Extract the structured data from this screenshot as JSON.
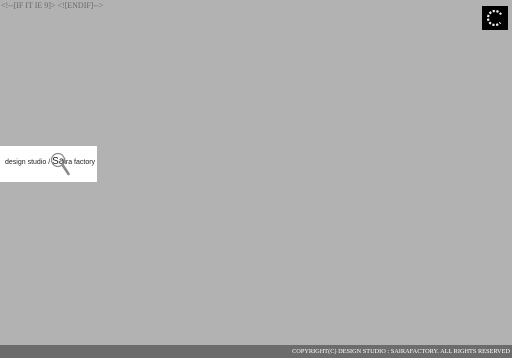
{
  "page": {
    "stray_comment": "<!--[IF IT IE 9]> <![ENDIF]-->"
  },
  "loader": {
    "icon": "spinner-icon",
    "color": "#000000"
  },
  "logo": {
    "prefix": "design studio / ",
    "highlight": "Sa",
    "suffix": "ira factory",
    "icon": "magnifier-icon"
  },
  "footer": {
    "copyright": "COPYRIGHT(C) DESIGN STUDIO : SAIRAFACTORY. ALL RIGHTS RESERVED"
  },
  "colors": {
    "background": "#b2b2b2",
    "footer": "#6c6c6c",
    "logo_panel": "#ffffff"
  }
}
